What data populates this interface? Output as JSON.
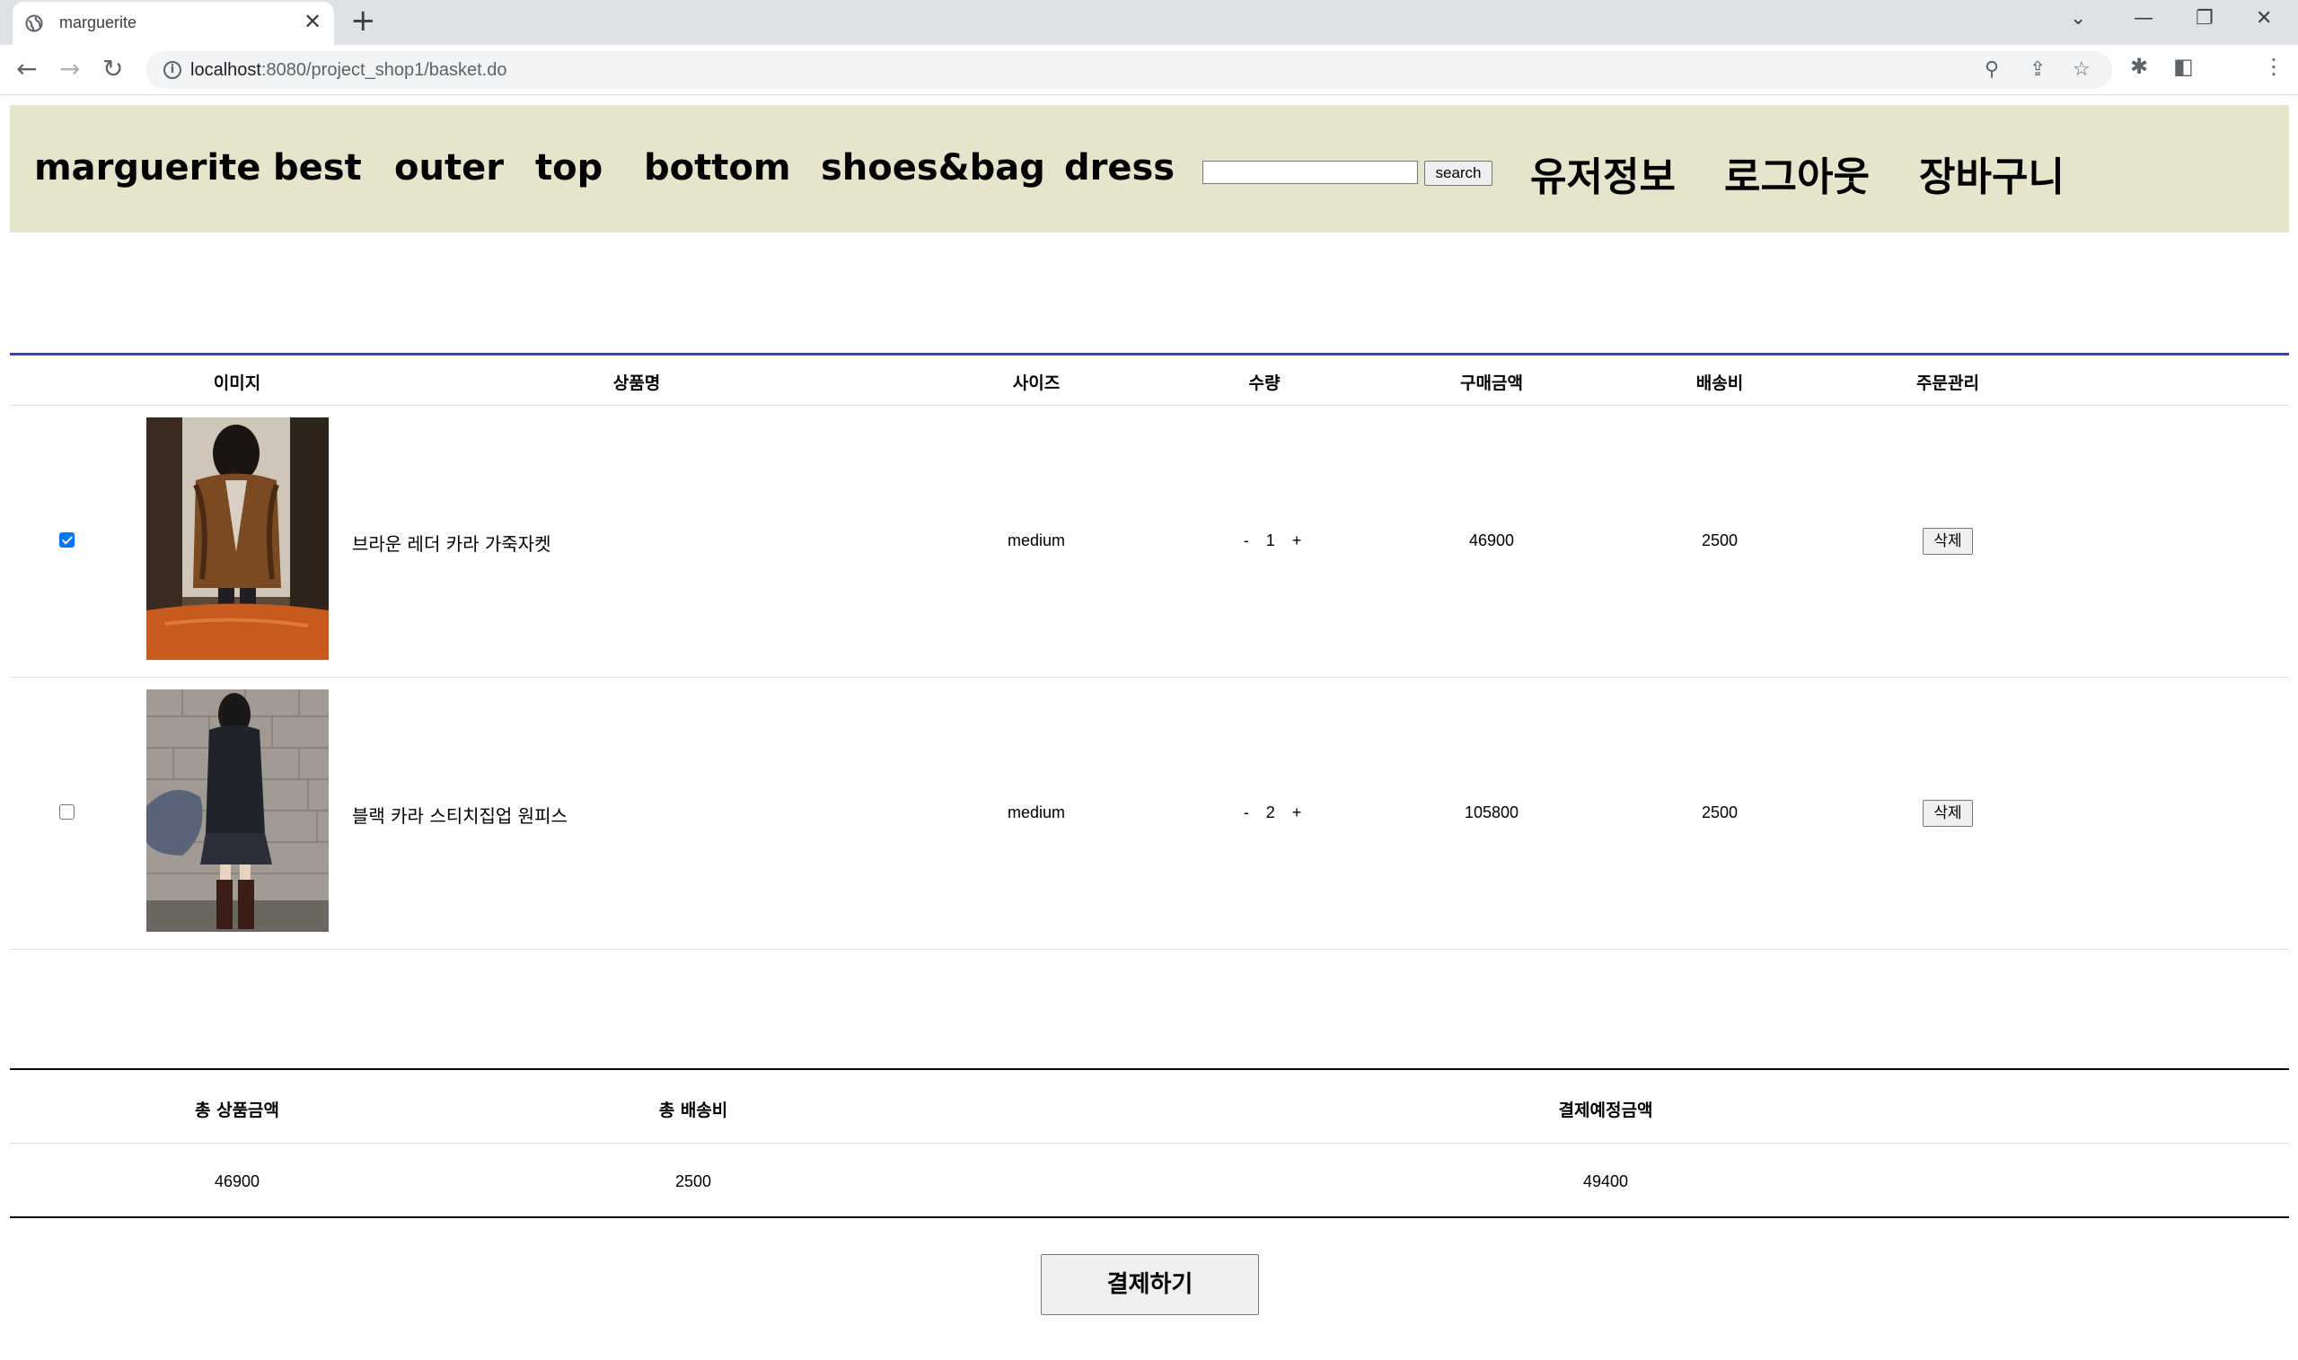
{
  "browser": {
    "tab_title": "marguerite",
    "new_tab_icon": "+",
    "url_host": "localhost",
    "url_path": ":8080/project_shop1/basket.do"
  },
  "header": {
    "brand": "marguerite",
    "nav": [
      "best",
      "outer",
      "top",
      "bottom",
      "shoes&bag",
      "dress"
    ],
    "search_value": "",
    "search_button": "search",
    "user_info": "유저정보",
    "logout": "로그아웃",
    "cart": "장바구니",
    "background": "#e5e5cd"
  },
  "table": {
    "columns": [
      "이미지",
      "상품명",
      "사이즈",
      "수량",
      "구매금액",
      "배송비",
      "주문관리"
    ],
    "rows": [
      {
        "checked": true,
        "name": "브라운 레더 카라 가죽자켓",
        "size": "medium",
        "qty_minus": "-",
        "qty": "1",
        "qty_plus": "+",
        "price": "46900",
        "shipping": "2500",
        "delete": "삭제"
      },
      {
        "checked": false,
        "name": "블랙 카라 스티치집업 원피스",
        "size": "medium",
        "qty_minus": "-",
        "qty": "2",
        "qty_plus": "+",
        "price": "105800",
        "shipping": "2500",
        "delete": "삭제"
      }
    ]
  },
  "summary": {
    "total_products_label": "총 상품금액",
    "total_shipping_label": "총 배송비",
    "expected_payment_label": "결제예정금액",
    "total_products": "46900",
    "total_shipping": "2500",
    "expected_payment": "49400"
  },
  "pay_button": "결제하기",
  "colors": {
    "table_top_border": "#3c3cc8",
    "checkbox_checked": "#0075ff"
  }
}
